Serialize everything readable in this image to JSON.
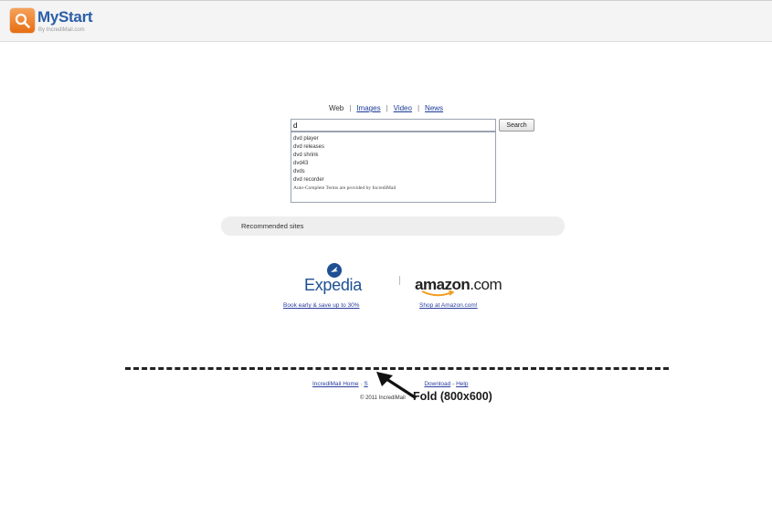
{
  "header": {
    "logo_text": "MyStart",
    "logo_sub": "By IncrediMail.com"
  },
  "tabs": [
    {
      "label": "Web",
      "active": true
    },
    {
      "label": "Images",
      "active": false
    },
    {
      "label": "Video",
      "active": false
    },
    {
      "label": "News",
      "active": false
    }
  ],
  "search": {
    "value": "d",
    "button_label": "Search",
    "suggestions": [
      "dvd player",
      "dvd releases",
      "dvd shrink",
      "dvd43",
      "dvds",
      "dvd recorder"
    ],
    "suggest_note": "Auto-Complete Terms are provided by IncrediMail"
  },
  "recommended": {
    "title": "Recommended sites",
    "expedia_name": "Expedia",
    "expedia_offer": "Book early & save up to 30%",
    "amazon_name_bold": "amazon",
    "amazon_name_rest": ".com",
    "amazon_offer": "Shop at Amazon.com!"
  },
  "footer": {
    "link_home": "IncrediMail Home",
    "link_s": "S",
    "link_download": "Download",
    "link_help": "Help",
    "copyright": "© 2011 IncrediMail"
  },
  "annotation": {
    "fold_label": "Fold (800x600)"
  },
  "colors": {
    "brand_blue": "#2b5ea7",
    "link_blue": "#2a3e9e",
    "logo_orange": "#e76d12"
  }
}
